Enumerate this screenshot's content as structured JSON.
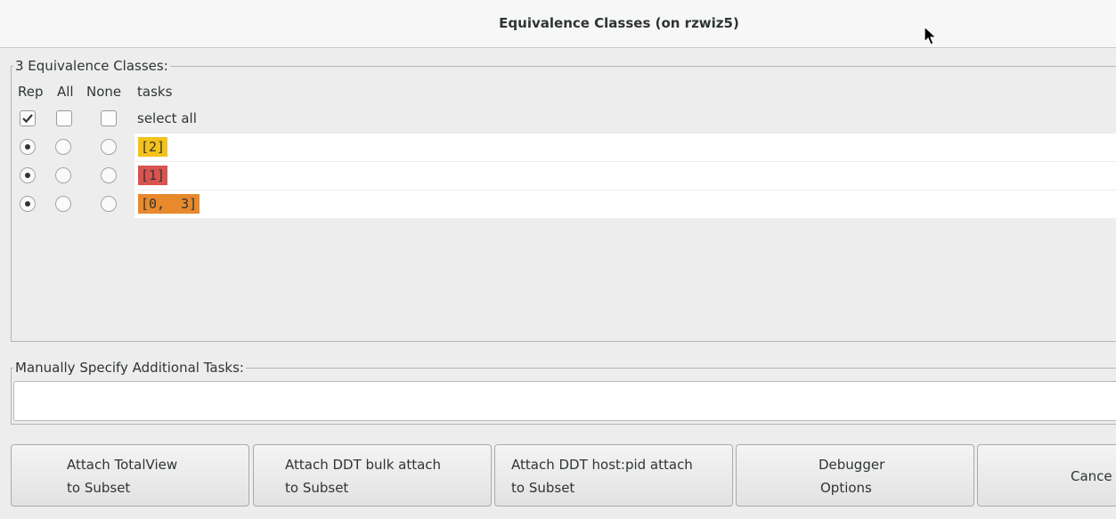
{
  "window": {
    "title": "Equivalence Classes (on rzwiz5)"
  },
  "classes": {
    "group_label": "3 Equivalence Classes:",
    "headers": {
      "rep": "Rep",
      "all": "All",
      "none": "None",
      "tasks": "tasks"
    },
    "select_all": {
      "label": "select all",
      "rep_checked": true,
      "all_checked": false,
      "none_checked": false
    },
    "rows": [
      {
        "tasks": "[2]",
        "color": "#f5c21b",
        "selected": "rep"
      },
      {
        "tasks": "[1]",
        "color": "#d9534f",
        "selected": "rep"
      },
      {
        "tasks": "[0,  3]",
        "color": "#e8892c",
        "selected": "rep"
      }
    ]
  },
  "manual": {
    "group_label": "Manually Specify Additional Tasks:",
    "value": ""
  },
  "buttons": [
    {
      "line1": "Attach TotalView",
      "line2": "to Subset"
    },
    {
      "line1": "Attach DDT bulk attach",
      "line2": "to Subset"
    },
    {
      "line1": "Attach DDT host:pid attach",
      "line2": "to Subset"
    },
    {
      "line1": "Debugger",
      "line2": "Options"
    },
    {
      "line1": "Cance"
    }
  ]
}
